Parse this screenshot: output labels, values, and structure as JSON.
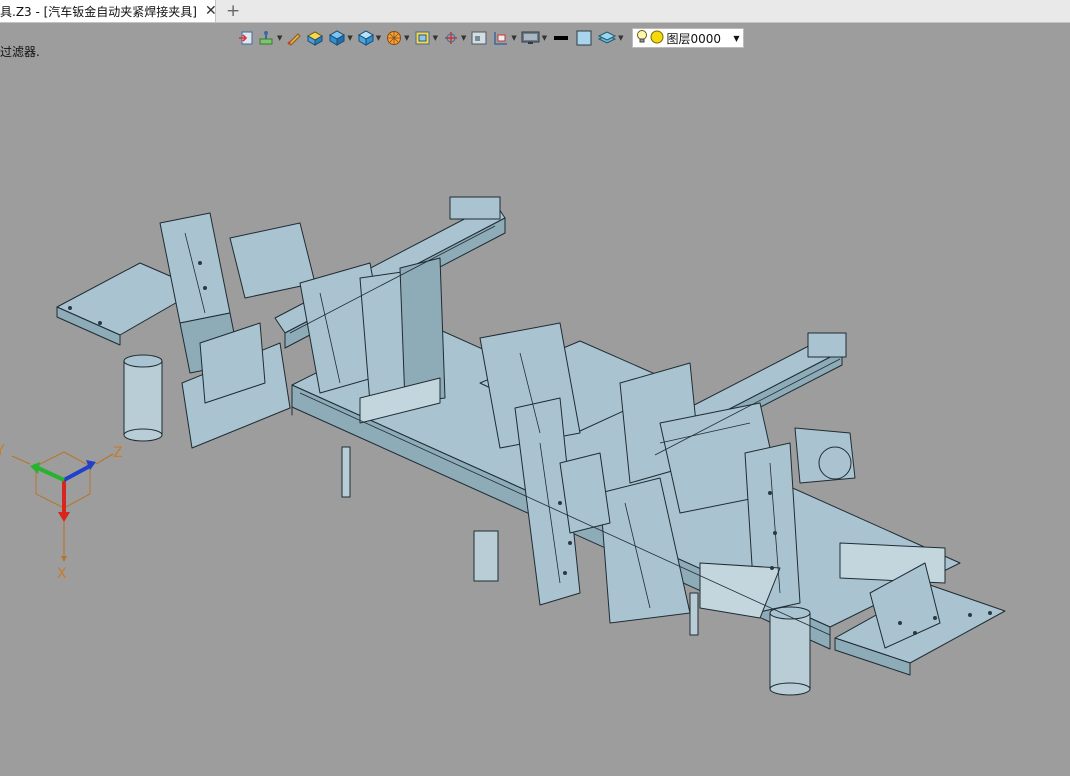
{
  "tab": {
    "title": "具.Z3 - [汽车钣金自动夹紧焊接夹具]",
    "close_glyph": "✕",
    "add_glyph": "+"
  },
  "viewport": {
    "filter_text": "过滤器."
  },
  "layer": {
    "name": "图层0000"
  },
  "triad": {
    "z_label": "Z",
    "x_label": "X",
    "y_label": "Y"
  },
  "colors": {
    "background": "#9d9d9d",
    "model_fill": "#a9c4d0",
    "model_edge": "#1f2c33"
  },
  "toolbar_icons": [
    "import-icon",
    "history-icon",
    "pen-icon",
    "color-box-icon",
    "solid-cube-icon",
    "shaded-cube-icon",
    "wheel-icon",
    "frame-icon",
    "axis-icon",
    "view-icon",
    "section-icon",
    "display-icon",
    "line-color-icon",
    "fill-color-icon",
    "layer-stack-icon",
    "bulb-icon",
    "layer-color-icon"
  ]
}
